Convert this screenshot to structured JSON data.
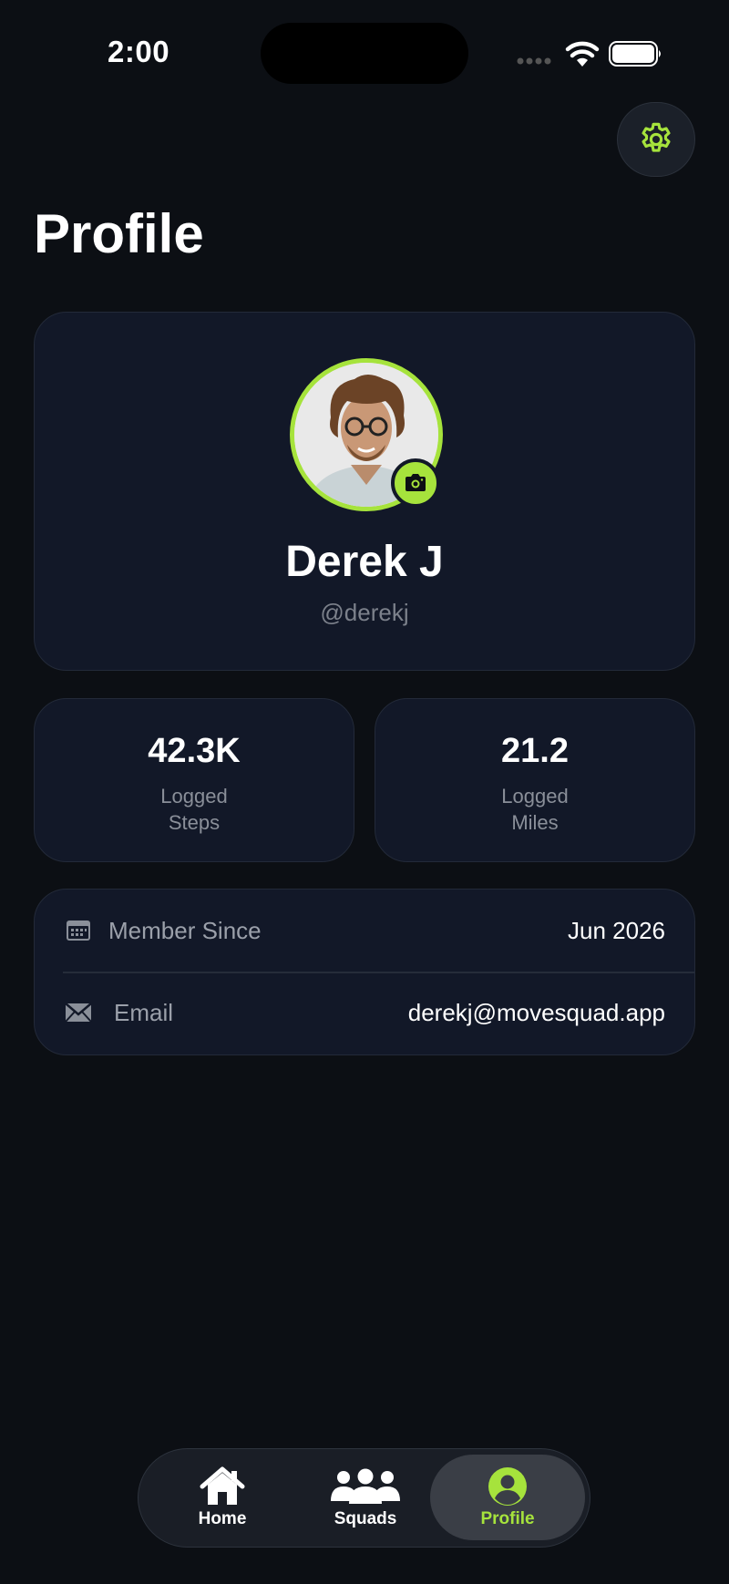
{
  "status_bar": {
    "time": "2:00"
  },
  "header": {
    "title": "Profile",
    "settings_icon": "gear-icon"
  },
  "profile": {
    "name": "Derek J",
    "handle": "@derekj",
    "avatar_icon": "profile-photo",
    "camera_icon": "camera-icon"
  },
  "stats": [
    {
      "value": "42.3K",
      "label_line1": "Logged",
      "label_line2": "Steps"
    },
    {
      "value": "21.2",
      "label_line1": "Logged",
      "label_line2": "Miles"
    }
  ],
  "info": [
    {
      "icon": "calendar-icon",
      "label": "Member Since",
      "value": "Jun 2026"
    },
    {
      "icon": "envelope-icon",
      "label": "Email",
      "value": "derekj@movesquad.app"
    }
  ],
  "tab_bar": {
    "tabs": [
      {
        "label": "Home",
        "icon": "home-icon",
        "active": false
      },
      {
        "label": "Squads",
        "icon": "group-icon",
        "active": false
      },
      {
        "label": "Profile",
        "icon": "user-circle-icon",
        "active": true
      }
    ]
  },
  "colors": {
    "accent": "#a6e33c",
    "background": "#0c0f14",
    "card": "#121828"
  }
}
